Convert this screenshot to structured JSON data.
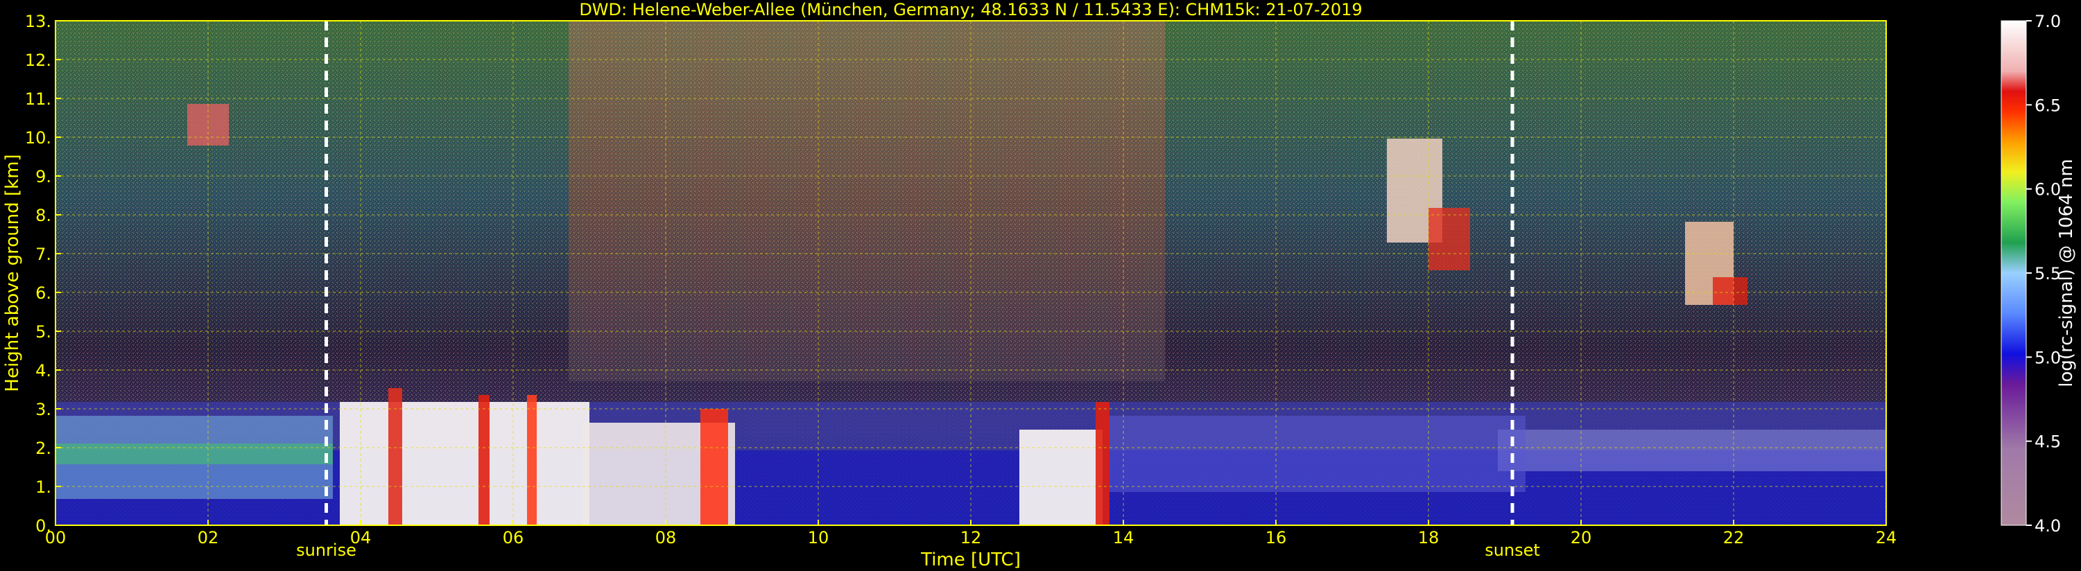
{
  "chart_data": {
    "type": "heatmap",
    "title": "DWD: Helene-Weber-Allee (München, Germany; 48.1633 N / 11.5433 E):    CHM15k: 21-07-2019",
    "xlabel": "Time [UTC]",
    "ylabel": "Height above ground [km]",
    "xlim": [
      0,
      24
    ],
    "ylim": [
      0,
      13
    ],
    "x_ticks": [
      "00",
      "02",
      "04",
      "06",
      "08",
      "10",
      "12",
      "14",
      "16",
      "18",
      "20",
      "22",
      "24"
    ],
    "y_ticks": [
      "0.",
      "1.",
      "2.",
      "3.",
      "4.",
      "5.",
      "6.",
      "7.",
      "8.",
      "9.",
      "10.",
      "11.",
      "12.",
      "13."
    ],
    "grid": true,
    "markers": [
      {
        "label": "sunrise",
        "x": 3.55
      },
      {
        "label": "sunset",
        "x": 19.1
      }
    ],
    "colorbar": {
      "label": "log(rc-signal) @ 1064 nm",
      "range": [
        4.0,
        7.0
      ],
      "ticks": [
        "4.0",
        "4.5",
        "5.0",
        "5.5",
        "6.0",
        "6.5",
        "7.0"
      ]
    },
    "colors": {
      "axis_text": "#ffff00",
      "grid": "#e0e000",
      "background": "#000000"
    }
  }
}
